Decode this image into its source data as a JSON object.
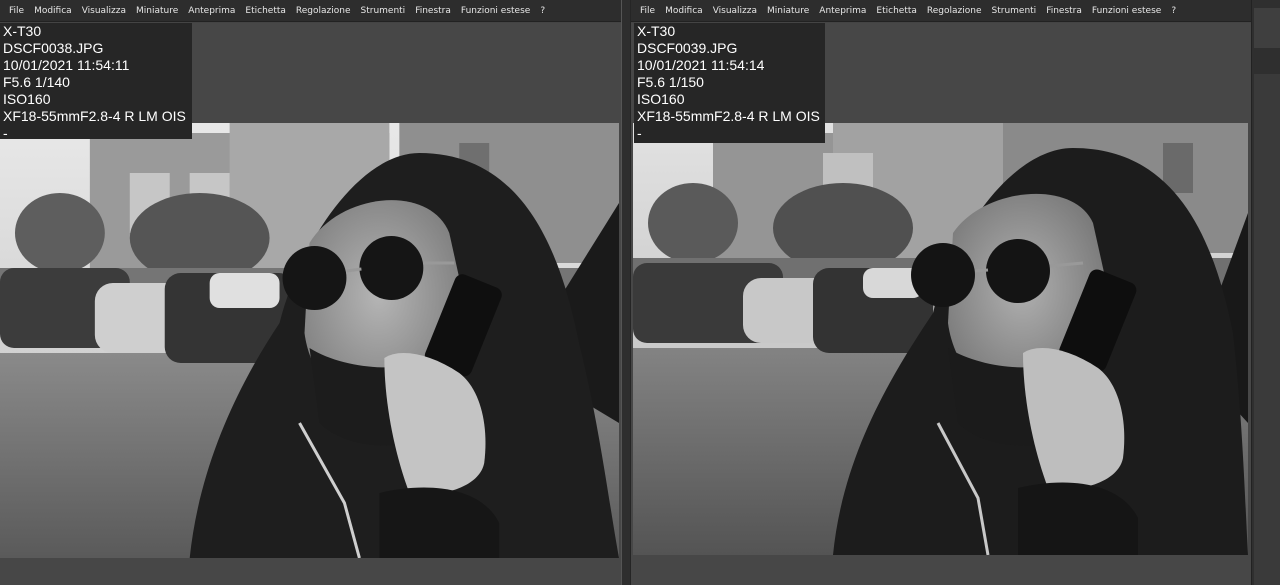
{
  "menu": {
    "items": [
      "File",
      "Modifica",
      "Visualizza",
      "Miniature",
      "Anteprima",
      "Etichetta",
      "Regolazione",
      "Strumenti",
      "Finestra",
      "Funzioni estese",
      "?"
    ]
  },
  "left": {
    "info": {
      "camera": "X-T30",
      "filename": "DSCF0038.JPG",
      "datetime": "10/01/2021 11:54:11",
      "exposure": "F5.6 1/140",
      "iso": "ISO160",
      "lens": "XF18-55mmF2.8-4 R LM OIS",
      "extra": "-"
    }
  },
  "right": {
    "info": {
      "camera": "X-T30",
      "filename": "DSCF0039.JPG",
      "datetime": "10/01/2021 11:54:14",
      "exposure": "F5.6 1/150",
      "iso": "ISO160",
      "lens": "XF18-55mmF2.8-4 R LM OIS",
      "extra": "-"
    }
  }
}
